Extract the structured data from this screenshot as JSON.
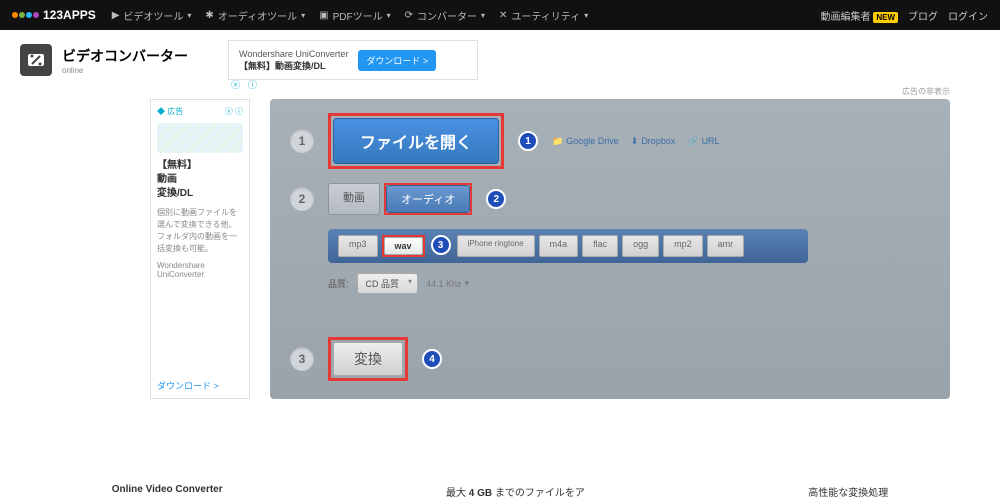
{
  "topbar": {
    "brand": "123APPS",
    "nav": [
      "ビデオツール",
      "オーディオツール",
      "PDFツール",
      "コンバーター",
      "ユーティリティ"
    ],
    "right": {
      "editor": "動画編集者",
      "badge": "NEW",
      "blog": "ブログ",
      "login": "ログイン"
    }
  },
  "app": {
    "title": "ビデオコンバーター",
    "sub": "online"
  },
  "ad_h": {
    "line1": "Wondershare UniConverter",
    "line2": "【無料】動画変換/DL",
    "btn": "ダウンロード >"
  },
  "ad_disclaimer": "広告の非表示",
  "ad_side": {
    "headline1": "【無料】",
    "headline2": "動画",
    "headline3": "変換/DL",
    "desc": "個別に動画ファイルを選んで変換できる他、フォルダ内の動画を一括変換も可能。",
    "brand": "Wondershare UniConverter",
    "dl": "ダウンロード >"
  },
  "step1": {
    "open": "ファイルを開く",
    "gdrive": "Google Drive",
    "dropbox": "Dropbox",
    "url": "URL"
  },
  "step2": {
    "tabs": {
      "video": "動画",
      "audio": "オーディオ"
    },
    "formats": [
      "mp3",
      "wav",
      "iPhone ringtone",
      "m4a",
      "flac",
      "ogg",
      "mp2",
      "amr"
    ],
    "quality_label": "品質:",
    "quality_val": "CD 品質",
    "freq": "44.1 Khz"
  },
  "step3": {
    "convert": "変換"
  },
  "footer": {
    "a": "Online Video Converter",
    "b_pre": "最大 ",
    "b_bold": "4 GB",
    "b_post": " までのファイルをア",
    "c": "高性能な変換処理"
  },
  "callouts": {
    "c1": "1",
    "c2": "2",
    "c3": "3",
    "c4": "4"
  }
}
